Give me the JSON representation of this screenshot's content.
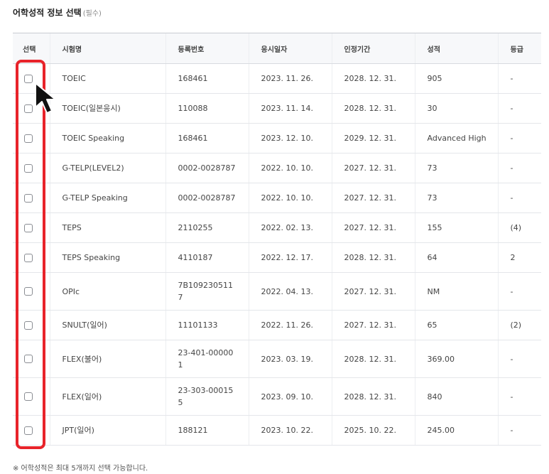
{
  "section": {
    "title": "어학성적 정보 선택",
    "required": "(필수)"
  },
  "columns": [
    "선택",
    "시험명",
    "등록번호",
    "응시일자",
    "인정기간",
    "성적",
    "등급"
  ],
  "rows": [
    {
      "exam": "TOEIC",
      "reg": "168461",
      "date": "2023. 11. 26.",
      "valid": "2028. 12. 31.",
      "score": "905",
      "grade": "-"
    },
    {
      "exam": "TOEIC(일본응시)",
      "reg": "110088",
      "date": "2023. 11. 14.",
      "valid": "2028. 12. 31.",
      "score": "30",
      "grade": "-"
    },
    {
      "exam": "TOEIC Speaking",
      "reg": "168461",
      "date": "2023. 12. 10.",
      "valid": "2029. 12. 31.",
      "score": "Advanced High",
      "grade": "-"
    },
    {
      "exam": "G-TELP(LEVEL2)",
      "reg": "0002-0028787",
      "date": "2022. 10. 10.",
      "valid": "2027. 12. 31.",
      "score": "73",
      "grade": "-"
    },
    {
      "exam": "G-TELP Speaking",
      "reg": "0002-0028787",
      "date": "2022. 10. 10.",
      "valid": "2027. 12. 31.",
      "score": "73",
      "grade": "-"
    },
    {
      "exam": "TEPS",
      "reg": "2110255",
      "date": "2022. 02. 13.",
      "valid": "2027. 12. 31.",
      "score": "155",
      "grade": "(4)"
    },
    {
      "exam": "TEPS Speaking",
      "reg": "4110187",
      "date": "2022. 12. 17.",
      "valid": "2028. 12. 31.",
      "score": "64",
      "grade": "2"
    },
    {
      "exam": "OPIc",
      "reg": "7B1092305117",
      "date": "2022. 04. 13.",
      "valid": "2027. 12. 31.",
      "score": "NM",
      "grade": "-"
    },
    {
      "exam": "SNULT(일어)",
      "reg": "11101133",
      "date": "2022. 11. 26.",
      "valid": "2027. 12. 31.",
      "score": "65",
      "grade": "(2)"
    },
    {
      "exam": "FLEX(불어)",
      "reg": "23-401-000001",
      "date": "2023. 03. 19.",
      "valid": "2028. 12. 31.",
      "score": "369.00",
      "grade": "-"
    },
    {
      "exam": "FLEX(일어)",
      "reg": "23-303-000155",
      "date": "2023. 09. 10.",
      "valid": "2028. 12. 31.",
      "score": "840",
      "grade": "-"
    },
    {
      "exam": "JPT(일어)",
      "reg": "188121",
      "date": "2023. 10. 22.",
      "valid": "2025. 10. 22.",
      "score": "245.00",
      "grade": "-"
    }
  ],
  "note": "※ 어학성적은 최대 5개까지 선택 가능합니다."
}
